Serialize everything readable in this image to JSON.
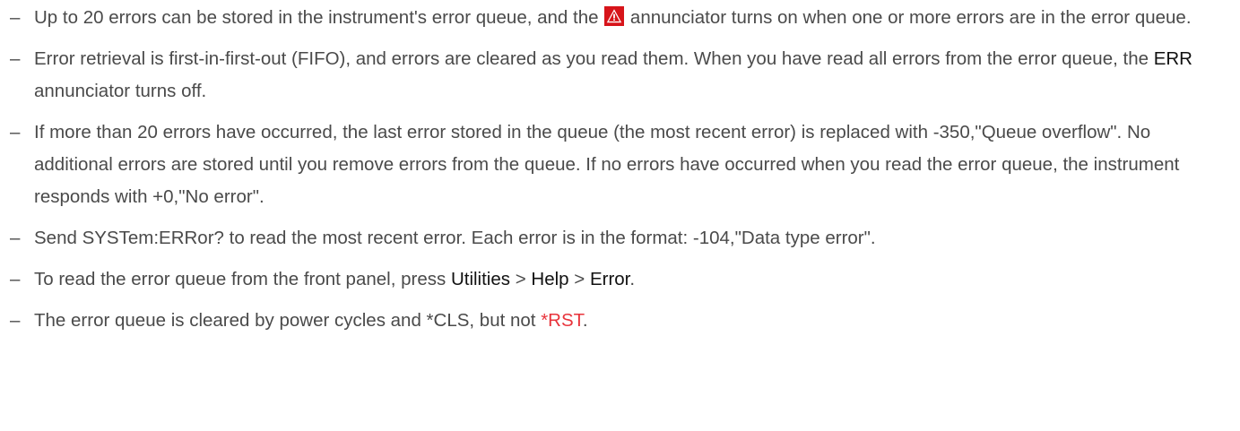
{
  "bullet_glyph": "–",
  "items": [
    {
      "t1": "Up to 20 errors can be stored in the instrument's error queue, and the ",
      "icon": "warning-annunciator-icon",
      "t2": " annunciator turns on when one or more errors are in the error queue."
    },
    {
      "t1": "Error retrieval is first-in-first-out (FIFO), and errors are cleared as you read them. When you have read all errors from the error queue, the ",
      "b1": "ERR",
      "t2": " annunciator turns off."
    },
    {
      "t1": "If more than 20 errors have occurred, the last error stored in the queue (the most recent error) is replaced with -350,\"Queue overflow\". No additional errors are stored until you remove errors from the queue. If no errors have occurred when you read the error queue, the instrument responds with +0,\"No error\"."
    },
    {
      "t1": "Send SYSTem:ERRor? to read the most recent error. Each error is in the format: -104,\"Data type error\"."
    },
    {
      "t1": "To read the error queue from the front panel, press ",
      "k1": "Utilities",
      "s1": " > ",
      "k2": "Help",
      "s2": " > ",
      "k3": "Error",
      "t2": "."
    },
    {
      "t1": "The error queue is cleared by power cycles and *CLS, but not ",
      "link": "*RST",
      "t2": "."
    }
  ],
  "colors": {
    "text": "#4a4a4a",
    "emphasis": "#111111",
    "link": "#e8333b",
    "icon_bg": "#d7141a",
    "icon_fg": "#ffffff"
  }
}
